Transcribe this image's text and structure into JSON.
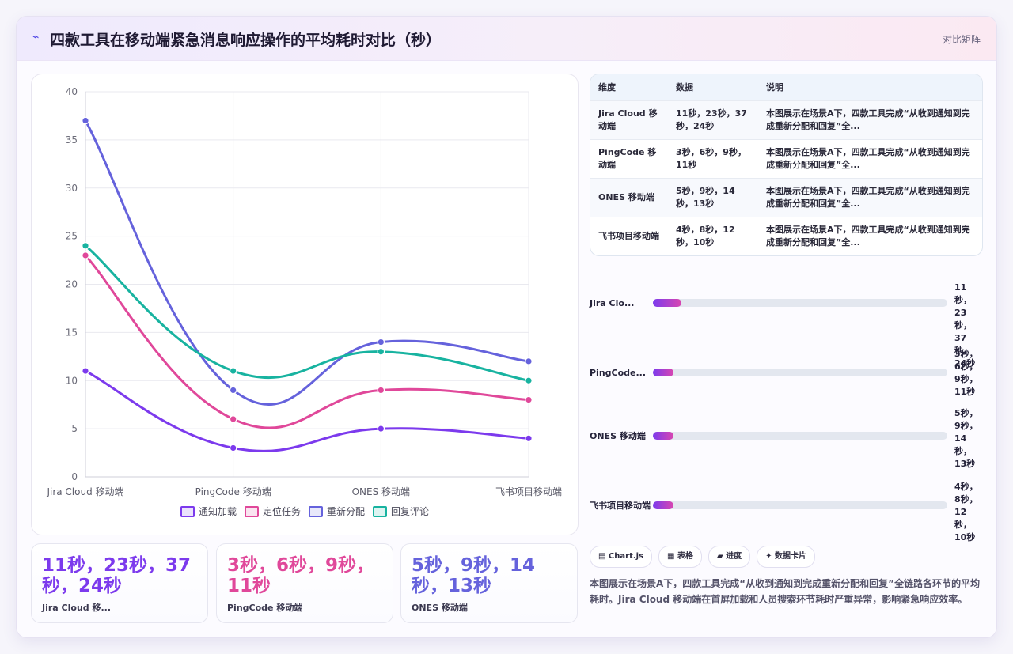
{
  "header": {
    "icon": "lightning-icon",
    "title": "四款工具在移动端紧急消息响应操作的平均耗时对比（秒）",
    "link": "对比矩阵"
  },
  "colors": {
    "series": [
      "#7c3aed",
      "#e0489a",
      "#6562dc",
      "#18b3a0"
    ],
    "accent": "#4f46e5"
  },
  "chart_data": {
    "type": "line",
    "categories": [
      "Jira Cloud 移动端",
      "PingCode 移动端",
      "ONES 移动端",
      "飞书项目移动端"
    ],
    "series": [
      {
        "name": "通知加载",
        "values": [
          11,
          3,
          5,
          4
        ]
      },
      {
        "name": "定位任务",
        "values": [
          23,
          6,
          9,
          8
        ]
      },
      {
        "name": "重新分配",
        "values": [
          37,
          9,
          14,
          12
        ]
      },
      {
        "name": "回复评论",
        "values": [
          24,
          11,
          13,
          10
        ]
      }
    ],
    "ylim": [
      0,
      40
    ],
    "yticks": [
      0,
      5,
      10,
      15,
      20,
      25,
      30,
      35,
      40
    ],
    "title": "",
    "xlabel": "",
    "ylabel": "",
    "grid": true,
    "legend": "bottom"
  },
  "stats": [
    {
      "value": "11秒，23秒，37秒，24秒",
      "label": "Jira Cloud 移..."
    },
    {
      "value": "3秒，6秒，9秒，11秒",
      "label": "PingCode 移动端"
    },
    {
      "value": "5秒，9秒，14秒，13秒",
      "label": "ONES 移动端"
    }
  ],
  "table": {
    "headers": [
      "维度",
      "数据",
      "说明"
    ],
    "rows": [
      [
        "Jira Cloud 移动端",
        "11秒，23秒，37秒，24秒",
        "本图展示在场景A下，四款工具完成“从收到通知到完成重新分配和回复”全..."
      ],
      [
        "PingCode 移动端",
        "3秒，6秒，9秒，11秒",
        "本图展示在场景A下，四款工具完成“从收到通知到完成重新分配和回复”全..."
      ],
      [
        "ONES 移动端",
        "5秒，9秒，14秒，13秒",
        "本图展示在场景A下，四款工具完成“从收到通知到完成重新分配和回复”全..."
      ],
      [
        "飞书项目移动端",
        "4秒，8秒，12秒，10秒",
        "本图展示在场景A下，四款工具完成“从收到通知到完成重新分配和回复”全..."
      ]
    ]
  },
  "progress": [
    {
      "label": "Jira Clo...",
      "value": "11秒，23秒，37秒，24秒",
      "fill_percent": 9.6
    },
    {
      "label": "PingCode...",
      "value": "3秒，6秒，9秒，11秒",
      "fill_percent": 7.0
    },
    {
      "label": "ONES 移动端",
      "value": "5秒，9秒，14秒，13秒",
      "fill_percent": 7.0
    },
    {
      "label": "飞书项目移动端",
      "value": "4秒，8秒，12秒，10秒",
      "fill_percent": 7.0
    }
  ],
  "tags": [
    "▤ Chart.js",
    "▦ 表格",
    "▰ 进度",
    "✦ 数据卡片"
  ],
  "description": "本图展示在场景A下，四款工具完成“从收到通知到完成重新分配和回复”全链路各环节的平均耗时。Jira Cloud 移动端在首屏加载和人员搜索环节耗时严重异常，影响紧急响应效率。"
}
